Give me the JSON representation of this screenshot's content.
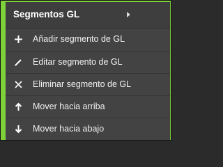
{
  "menu": {
    "title": "Segmentos GL",
    "items": [
      {
        "label": "Añadir segmento de GL",
        "icon": "plus-icon"
      },
      {
        "label": "Editar segmento de GL",
        "icon": "pencil-icon"
      },
      {
        "label": "Eliminar segmento de GL",
        "icon": "close-icon"
      },
      {
        "label": "Mover hacia arriba",
        "icon": "arrow-up-icon"
      },
      {
        "label": "Mover hacia abajo",
        "icon": "arrow-down-icon"
      }
    ]
  },
  "colors": {
    "accent": "#7fd13a",
    "menu_bg": "#434343",
    "header_bg": "#3e3e3e",
    "text": "#ffffff"
  }
}
